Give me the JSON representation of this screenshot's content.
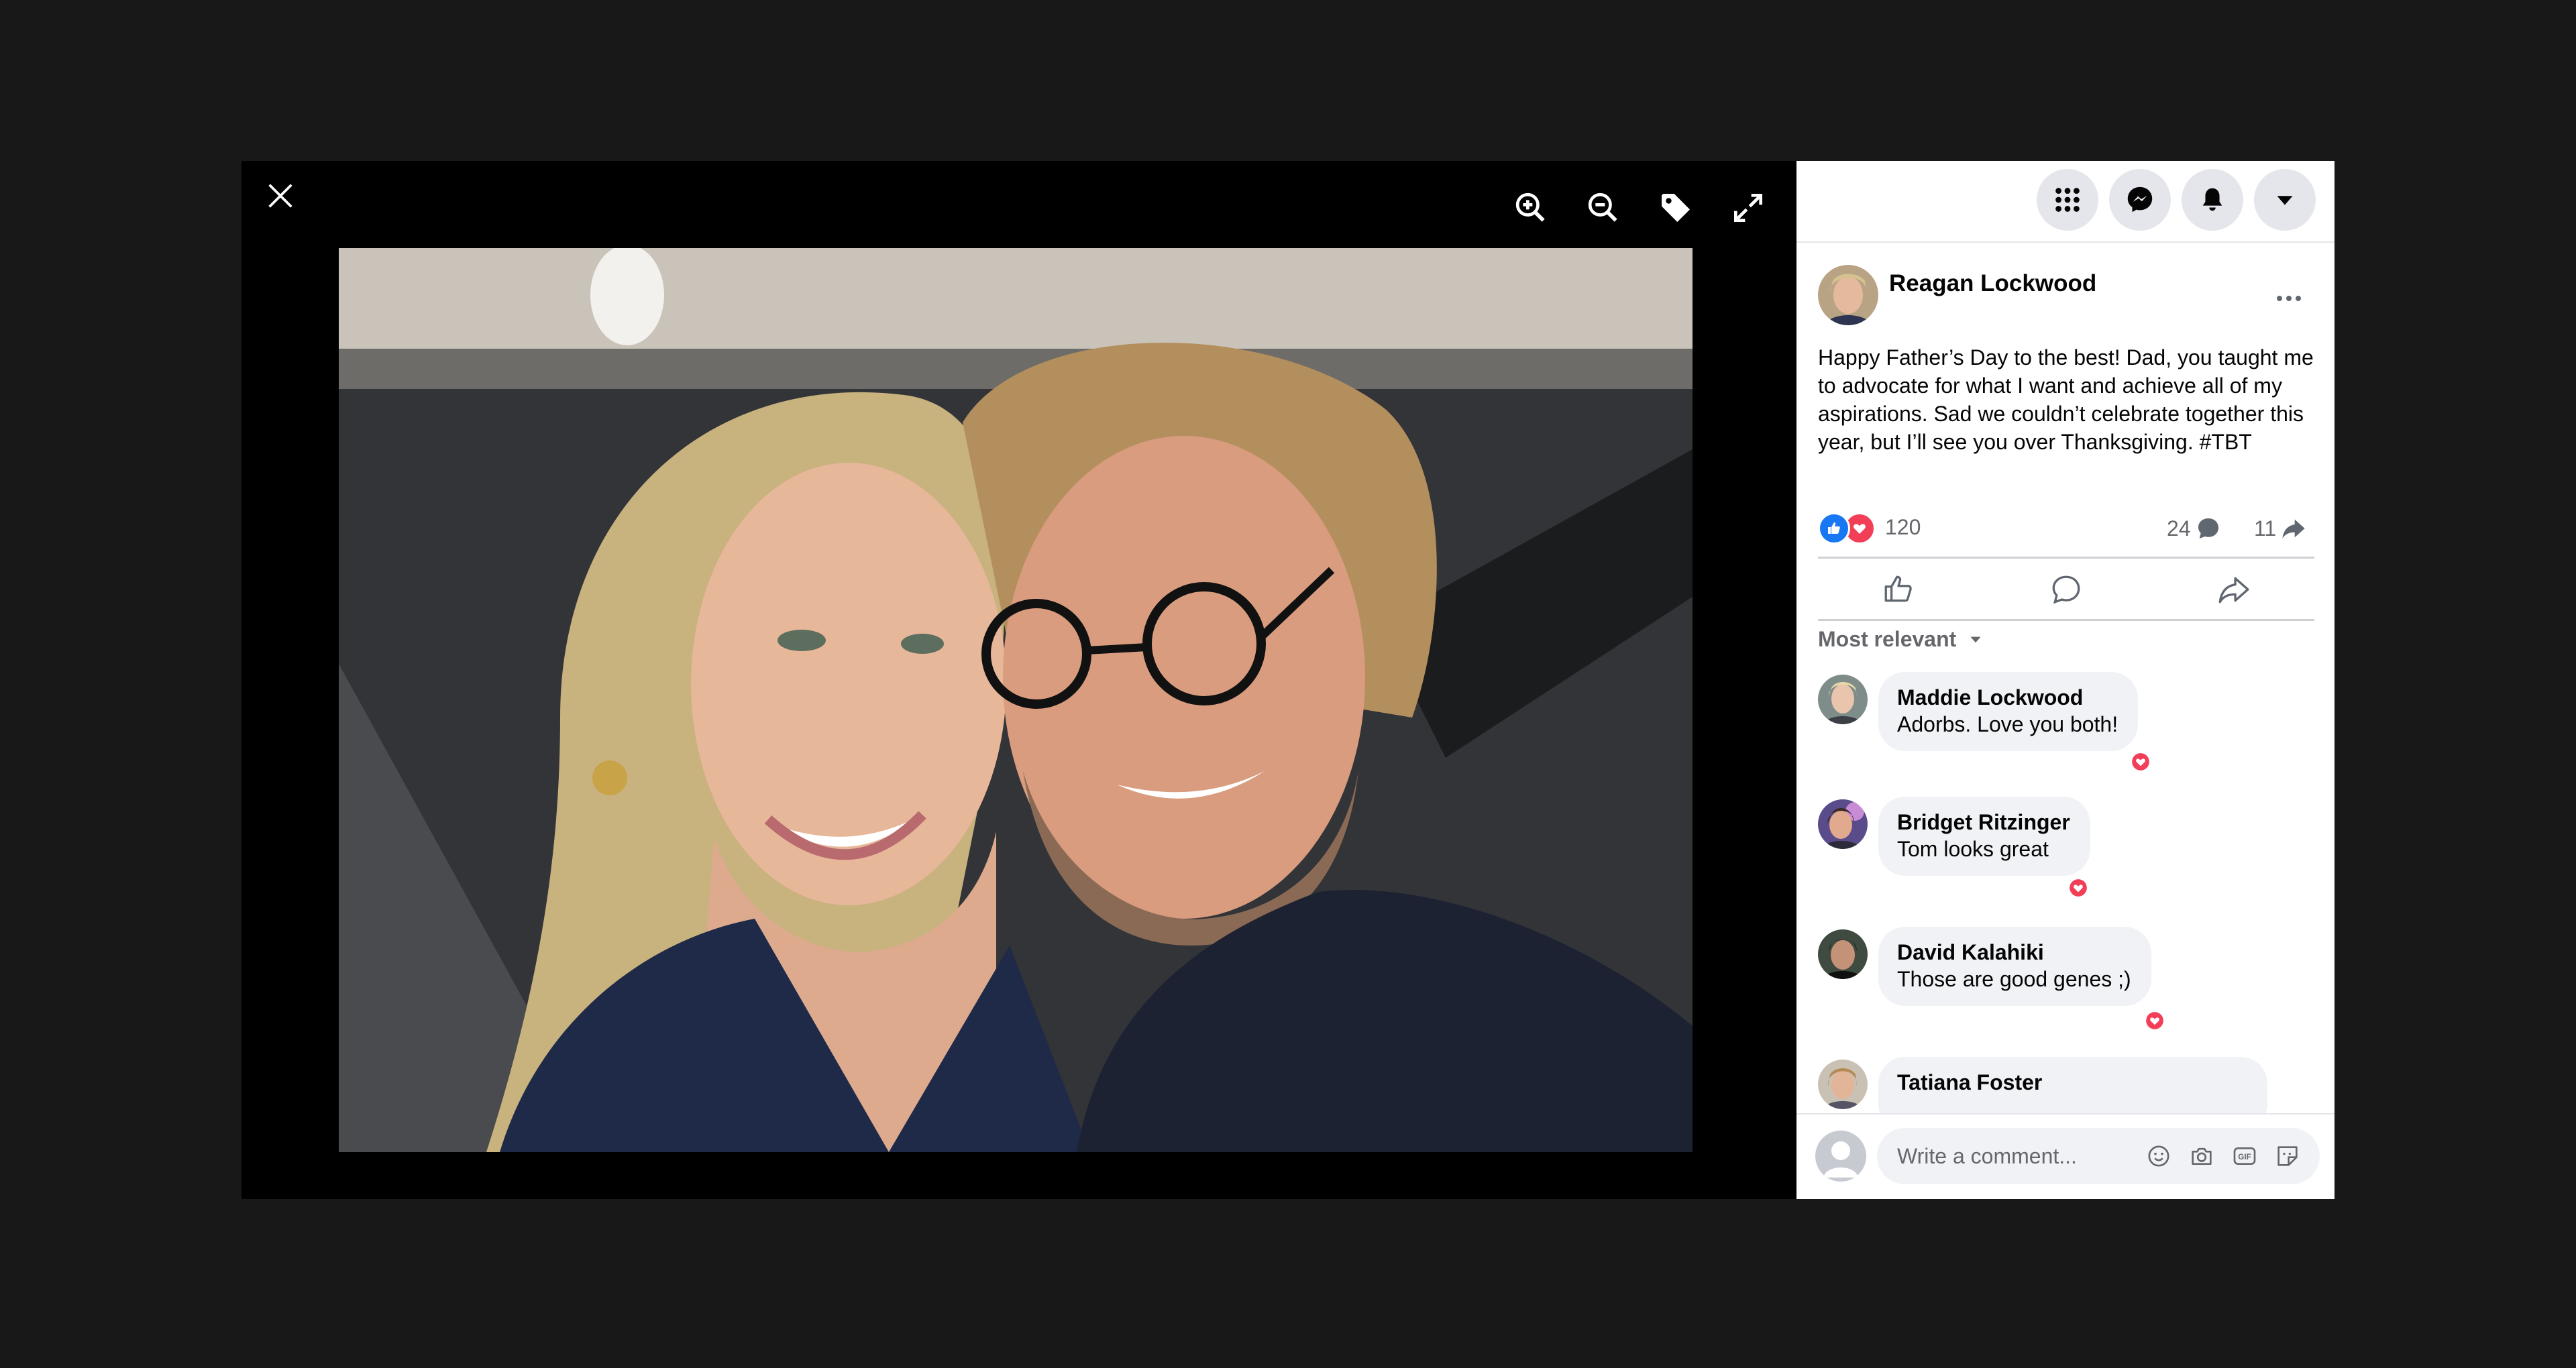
{
  "viewer": {
    "close_icon": "close-icon",
    "zoom_in_icon": "zoom-in-icon",
    "zoom_out_icon": "zoom-out-icon",
    "tag_icon": "tag-icon",
    "fullscreen_icon": "fullscreen-icon"
  },
  "topbar": {
    "menu_icon": "grid-menu-icon",
    "messenger_icon": "messenger-icon",
    "notifications_icon": "bell-icon",
    "account_icon": "caret-down-icon"
  },
  "post": {
    "author": "Reagan Lockwood",
    "text": "Happy Father’s Day to the best! Dad, you taught me to advocate for what I want and achieve all of my aspirations. Sad we couldn’t celebrate together this year, but I’ll see you over Thanksgiving. #TBT",
    "reaction_count": "120",
    "comment_count": "24",
    "share_count": "11"
  },
  "sort_label": "Most relevant",
  "comments": [
    {
      "name": "Maddie Lockwood",
      "text": "Adorbs. Love you both!"
    },
    {
      "name": "Bridget Ritzinger",
      "text": "Tom looks great"
    },
    {
      "name": "David Kalahiki",
      "text": "Those are good genes ;)"
    },
    {
      "name": "Tatiana Foster",
      "text": ""
    }
  ],
  "comment_box": {
    "placeholder": "Write a comment..."
  },
  "colors": {
    "facebook_blue": "#1877f2",
    "love_red": "#f33e58",
    "panel_bg": "#ffffff",
    "viewer_bg": "#000000"
  }
}
